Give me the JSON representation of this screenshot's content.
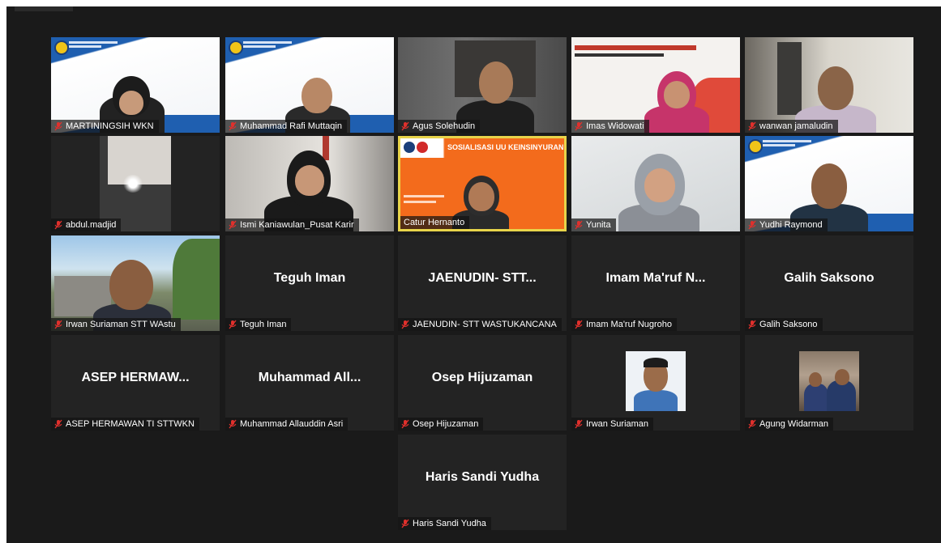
{
  "participants": [
    {
      "caption": "MARTININGSIH WKN",
      "kind": "video",
      "bg": "banner"
    },
    {
      "caption": "Muhammad Rafi Muttaqin",
      "kind": "video",
      "bg": "banner"
    },
    {
      "caption": "Agus Solehudin",
      "kind": "video",
      "bg": "room"
    },
    {
      "caption": "Imas Widowati",
      "kind": "video",
      "bg": "poster"
    },
    {
      "caption": "wanwan jamaludin",
      "kind": "video",
      "bg": "office"
    },
    {
      "caption": "abdul.madjid",
      "kind": "video",
      "bg": "dark"
    },
    {
      "caption": "Ismi Kaniawulan_Pusat Karir",
      "kind": "video",
      "bg": "room"
    },
    {
      "caption": "Catur Hernanto",
      "kind": "video",
      "bg": "slide",
      "active": true,
      "slide_title": "SOSIALISASI UU KEINSINYURAN"
    },
    {
      "caption": "Yunita",
      "kind": "video",
      "bg": "wall"
    },
    {
      "caption": "Yudhi Raymond",
      "kind": "video",
      "bg": "banner"
    },
    {
      "caption": "Irwan Suriaman STT WAstu",
      "kind": "video",
      "bg": "outdoor"
    },
    {
      "caption": "Teguh Iman",
      "kind": "name",
      "display_name": "Teguh Iman"
    },
    {
      "caption": "JAENUDIN- STT WASTUKANCANA",
      "kind": "name",
      "display_name": "JAENUDIN-  STT..."
    },
    {
      "caption": "Imam Ma'ruf Nugroho",
      "kind": "name",
      "display_name": "Imam  Ma'ruf  N..."
    },
    {
      "caption": "Galih Saksono",
      "kind": "name",
      "display_name": "Galih Saksono"
    },
    {
      "caption": "ASEP HERMAWAN TI STTWKN",
      "kind": "name",
      "display_name": "ASEP  HERMAW..."
    },
    {
      "caption": "Muhammad Allauddin Asri",
      "kind": "name",
      "display_name": "Muhammad  All..."
    },
    {
      "caption": "Osep Hijuzaman",
      "kind": "name",
      "display_name": "Osep Hijuzaman"
    },
    {
      "caption": "Irwan Suriaman",
      "kind": "photo",
      "bg": "portrait"
    },
    {
      "caption": "Agung Widarman",
      "kind": "photo",
      "bg": "group"
    },
    {
      "caption": "Haris Sandi Yudha",
      "kind": "name",
      "display_name": "Haris Sandi Yudha"
    }
  ],
  "colors": {
    "background": "#1a1a1a",
    "tile": "#232323",
    "active_border": "#e8d44a",
    "mute_icon": "#e0302c"
  }
}
